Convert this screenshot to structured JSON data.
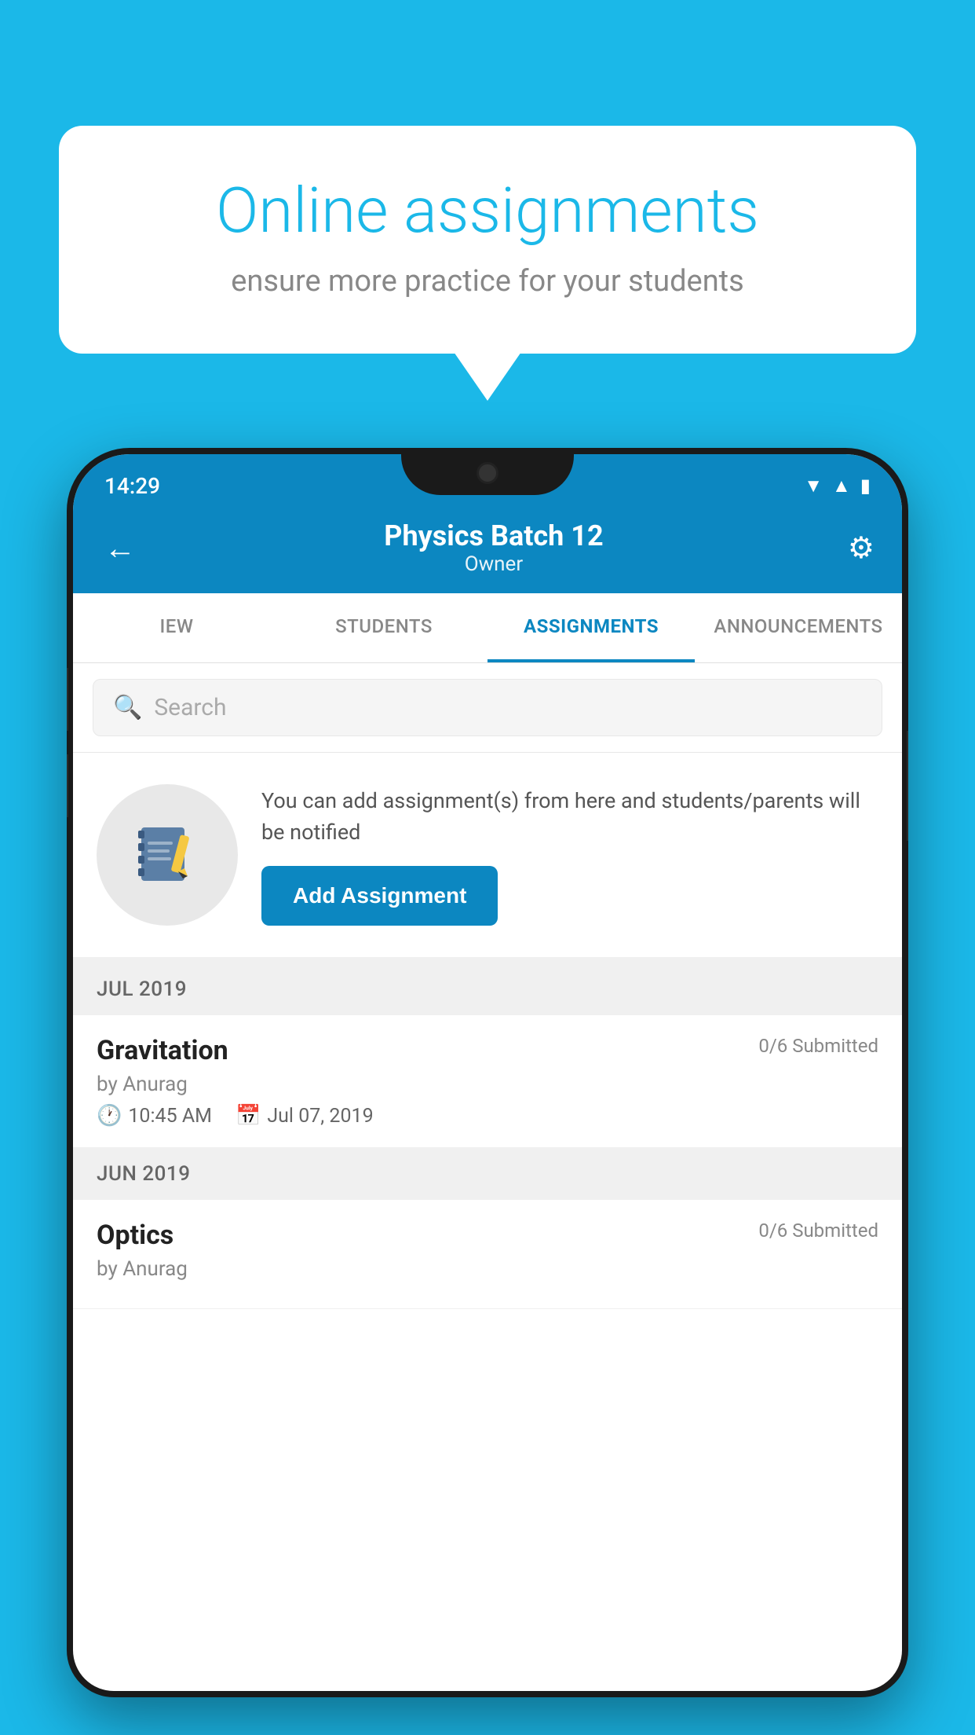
{
  "background": {
    "color": "#1BB8E8"
  },
  "speech_bubble": {
    "title": "Online assignments",
    "subtitle": "ensure more practice for your students"
  },
  "phone": {
    "status_bar": {
      "time": "14:29",
      "icons": [
        "wifi",
        "signal",
        "battery"
      ]
    },
    "header": {
      "title": "Physics Batch 12",
      "subtitle": "Owner",
      "back_label": "←",
      "settings_label": "⚙"
    },
    "tabs": [
      {
        "label": "IEW",
        "active": false
      },
      {
        "label": "STUDENTS",
        "active": false
      },
      {
        "label": "ASSIGNMENTS",
        "active": true
      },
      {
        "label": "ANNOUNCEMENTS",
        "active": false
      }
    ],
    "search": {
      "placeholder": "Search"
    },
    "promo": {
      "text": "You can add assignment(s) from here and students/parents will be notified",
      "button_label": "Add Assignment"
    },
    "sections": [
      {
        "month": "JUL 2019",
        "assignments": [
          {
            "name": "Gravitation",
            "submitted": "0/6 Submitted",
            "by": "by Anurag",
            "time": "10:45 AM",
            "date": "Jul 07, 2019"
          }
        ]
      },
      {
        "month": "JUN 2019",
        "assignments": [
          {
            "name": "Optics",
            "submitted": "0/6 Submitted",
            "by": "by Anurag",
            "time": "",
            "date": ""
          }
        ]
      }
    ]
  }
}
